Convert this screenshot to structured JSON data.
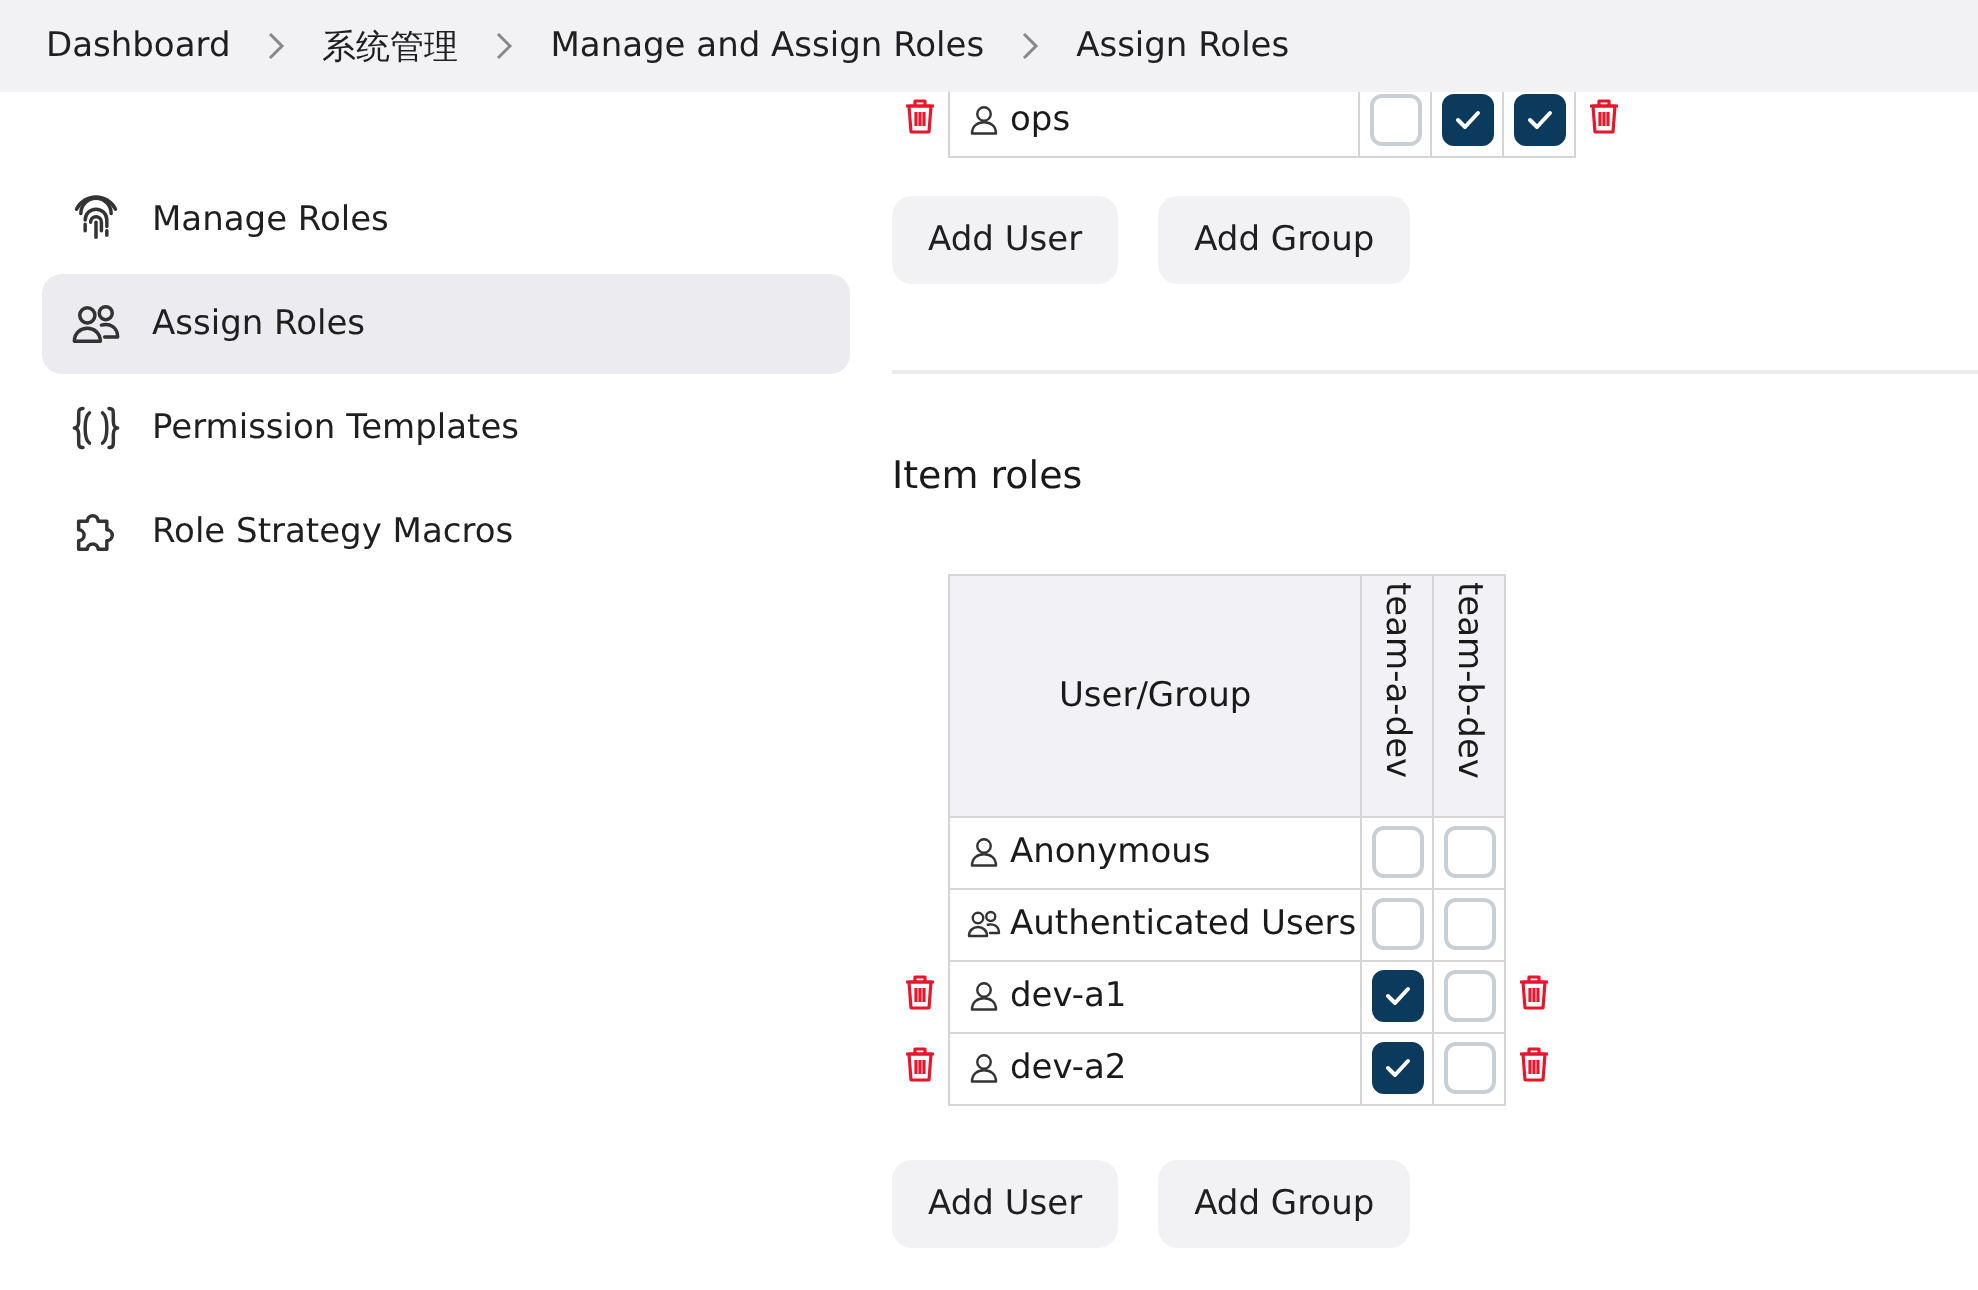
{
  "breadcrumbs": [
    {
      "label": "Dashboard"
    },
    {
      "label": "系统管理"
    },
    {
      "label": "Manage and Assign Roles"
    },
    {
      "label": "Assign Roles"
    }
  ],
  "sidebar": {
    "items": [
      {
        "label": "Manage Roles",
        "selected": false
      },
      {
        "label": "Assign Roles",
        "selected": true
      },
      {
        "label": "Permission Templates",
        "selected": false
      },
      {
        "label": "Role Strategy Macros",
        "selected": false
      }
    ]
  },
  "global_roles": {
    "rows": [
      {
        "name": "ops",
        "kind": "user",
        "removable": true,
        "checks": [
          false,
          true,
          true
        ]
      }
    ],
    "buttons": [
      "Add User",
      "Add Group"
    ]
  },
  "item_roles": {
    "heading": "Item roles",
    "header": "User/Group",
    "columns": [
      "team-a-dev",
      "team-b-dev"
    ],
    "rows": [
      {
        "name": "Anonymous",
        "kind": "user",
        "removable": false,
        "checks": [
          false,
          false
        ]
      },
      {
        "name": "Authenticated Users",
        "kind": "group",
        "removable": false,
        "checks": [
          false,
          false
        ]
      },
      {
        "name": "dev-a1",
        "kind": "user",
        "removable": true,
        "checks": [
          true,
          false
        ]
      },
      {
        "name": "dev-a2",
        "kind": "user",
        "removable": true,
        "checks": [
          true,
          false
        ]
      }
    ],
    "buttons": [
      "Add User",
      "Add Group"
    ]
  }
}
